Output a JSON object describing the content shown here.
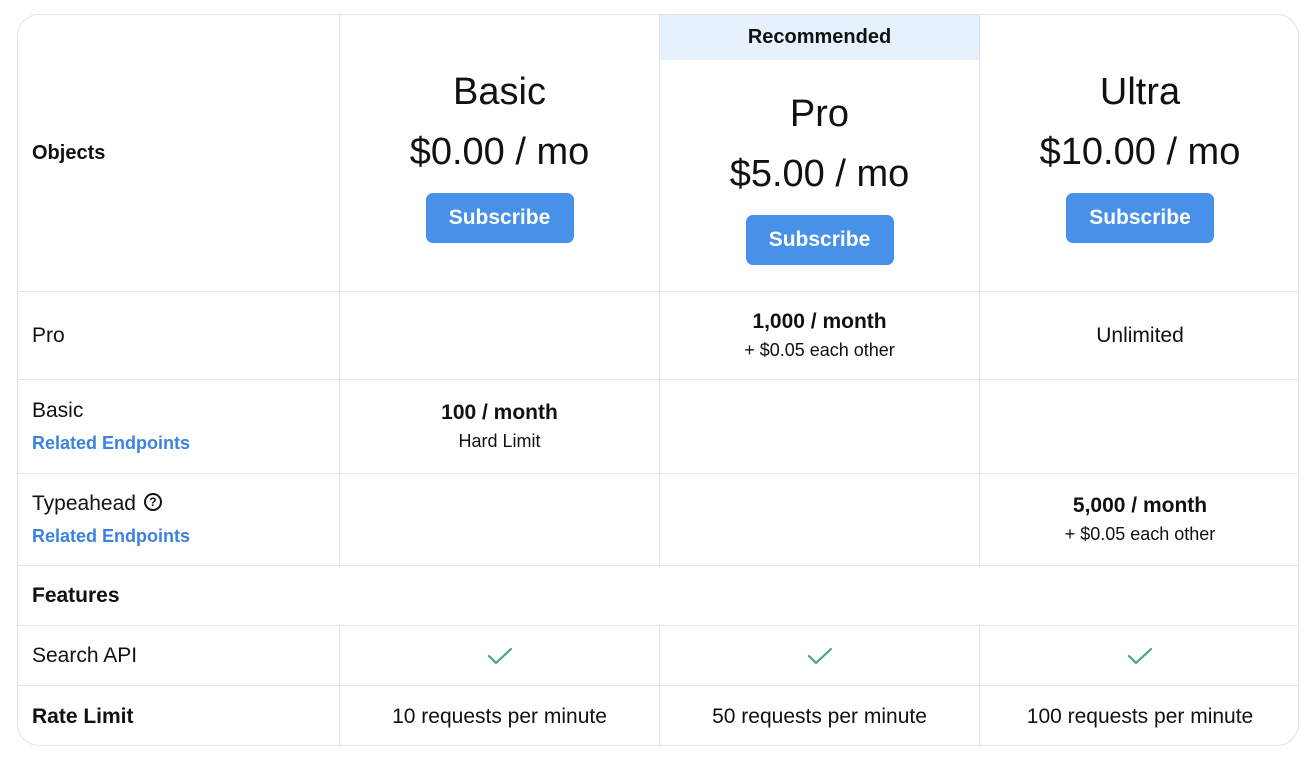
{
  "header": {
    "objects_label": "Objects",
    "recommended_label": "Recommended"
  },
  "plans": [
    {
      "name": "Basic",
      "price": "$0.00 / mo",
      "button": "Subscribe"
    },
    {
      "name": "Pro",
      "price": "$5.00 / mo",
      "button": "Subscribe"
    },
    {
      "name": "Ultra",
      "price": "$10.00 / mo",
      "button": "Subscribe"
    }
  ],
  "rows": {
    "pro": {
      "label": "Pro",
      "pro_quota": "1,000 / month",
      "pro_extra": "+ $0.05 each other",
      "ultra_value": "Unlimited"
    },
    "basic": {
      "label": "Basic",
      "link": "Related Endpoints",
      "basic_quota": "100 / month",
      "basic_extra": "Hard Limit"
    },
    "typeahead": {
      "label": "Typeahead",
      "link": "Related Endpoints",
      "ultra_quota": "5,000 / month",
      "ultra_extra": "+ $0.05 each other"
    }
  },
  "features": {
    "label": "Features",
    "search_api": {
      "label": "Search API"
    },
    "rate_limit": {
      "label": "Rate Limit",
      "basic": "10 requests per minute",
      "pro": "50 requests per minute",
      "ultra": "100 requests per minute"
    }
  },
  "colors": {
    "accent": "#4791e9",
    "link": "#3b82e0",
    "check": "#4aa38a",
    "recommended_bg": "#e6f1fc"
  }
}
